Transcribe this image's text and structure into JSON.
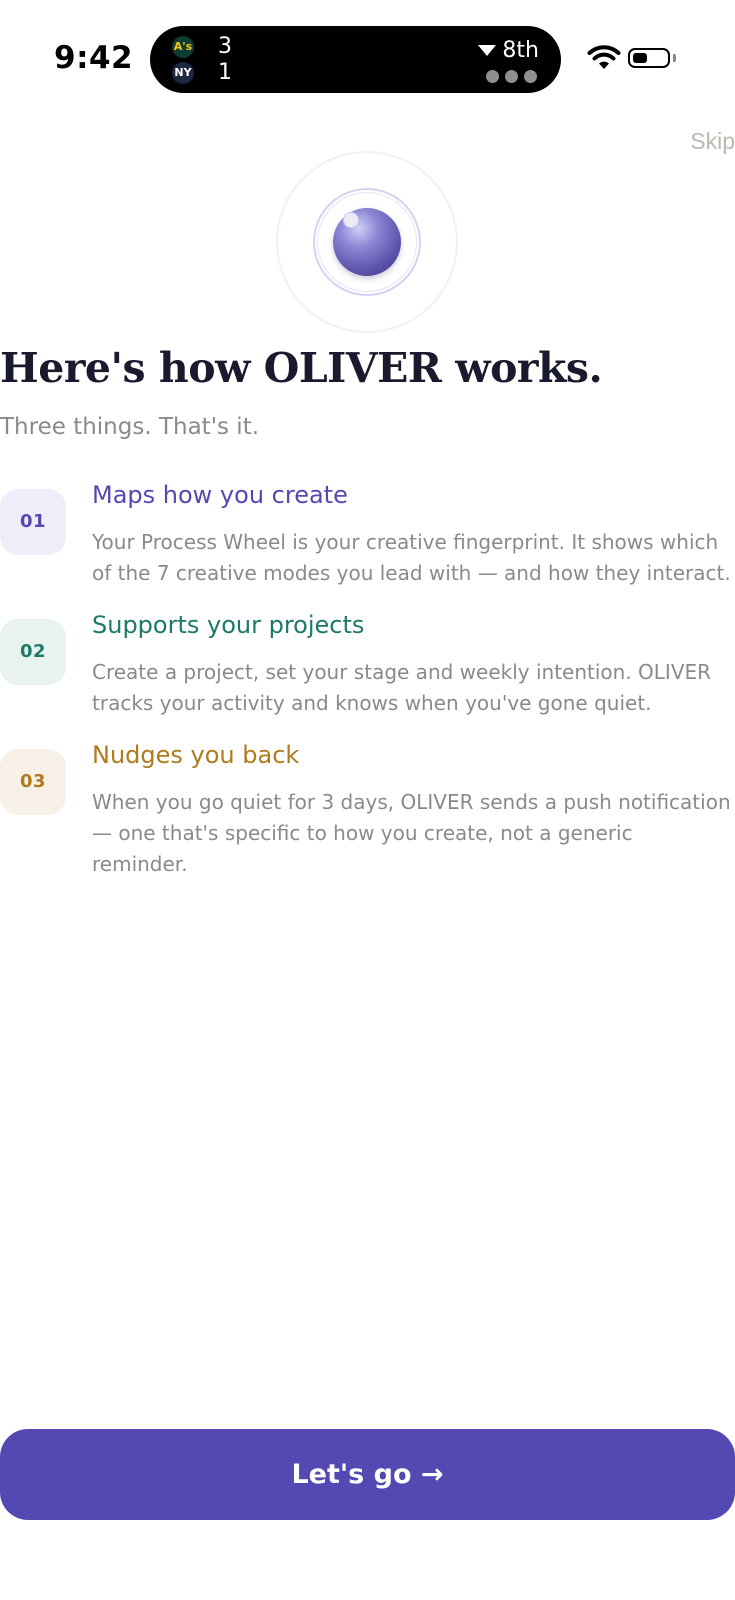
{
  "status_bar": {
    "time": "9:42",
    "live_activity": {
      "team_a_logo": "A's",
      "team_a_score": "3",
      "team_b_logo": "NY",
      "team_b_score": "1",
      "inning": "8th"
    },
    "icons": [
      "wifi-icon",
      "battery-icon"
    ]
  },
  "skip_label": "Skip",
  "headline": "Here's how OLIVER works.",
  "subhead": "Three things. That's it.",
  "steps": [
    {
      "number": "01",
      "title": "Maps how you create",
      "description": "Your Process Wheel is your creative fingerprint. It shows which of the 7 creative modes you lead with — and how they interact.",
      "color": "#5448b2",
      "badge_bg": "#efedf8"
    },
    {
      "number": "02",
      "title": "Supports your projects",
      "description": "Create a project, set your stage and weekly intention. OLIVER tracks your activity and knows when you've gone quiet.",
      "color": "#1d7a66",
      "badge_bg": "#e8f3f0"
    },
    {
      "number": "03",
      "title": "Nudges you back",
      "description": "When you go quiet for 3 days, OLIVER sends a push notification — one that's specific to how you create, not a generic reminder.",
      "color": "#b07a1e",
      "badge_bg": "#f8f1e7"
    }
  ],
  "cta_label": "Let's go →",
  "colors": {
    "accent": "#5448b2",
    "text_primary": "#1a1a2e",
    "text_secondary": "#8a8a8a"
  }
}
